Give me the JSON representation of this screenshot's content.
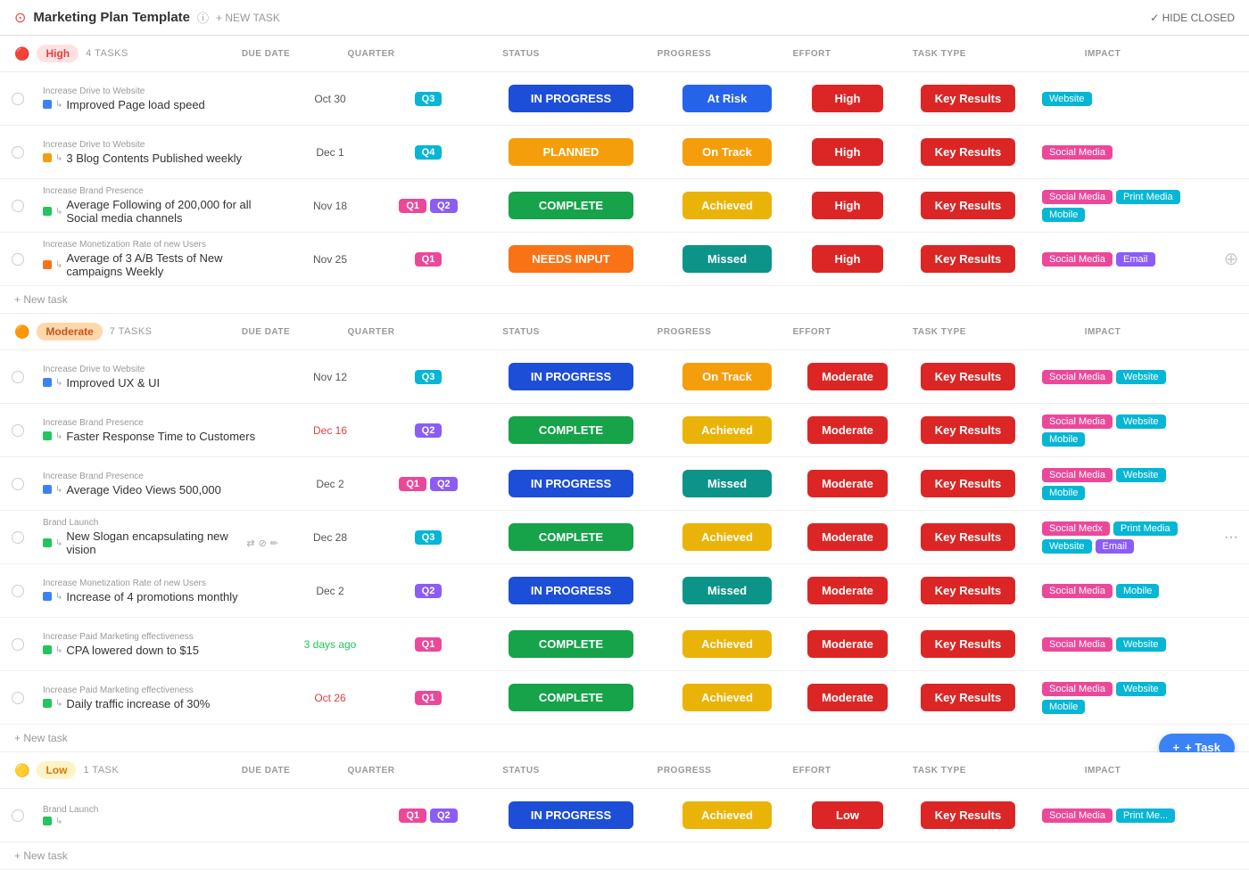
{
  "app": {
    "title": "Marketing Plan Template",
    "new_task_label": "+ NEW TASK",
    "hide_closed_label": "✓ HIDE CLOSED"
  },
  "sections": [
    {
      "id": "high",
      "priority": "High",
      "priority_class": "priority-high",
      "task_count": "4 TASKS",
      "columns": [
        "DUE DATE",
        "QUARTER",
        "STATUS",
        "PROGRESS",
        "EFFORT",
        "TASK TYPE",
        "IMPACT"
      ],
      "tasks": [
        {
          "group": "Increase Drive to Website",
          "name": "Improved Page load speed",
          "dot_class": "dot-blue",
          "due": "Oct 30",
          "due_class": "",
          "quarters": [
            {
              "label": "Q3",
              "class": "q3"
            }
          ],
          "status": "IN PROGRESS",
          "status_class": "status-inprogress",
          "progress": "At Risk",
          "progress_class": "progress-atrisk",
          "effort": "High",
          "task_type": "Key Results",
          "impacts": [
            {
              "label": "Website",
              "class": "tag-cyan"
            }
          ]
        },
        {
          "group": "Increase Drive to Website",
          "name": "3 Blog Contents Published weekly",
          "dot_class": "dot-yellow",
          "due": "Dec 1",
          "due_class": "",
          "quarters": [
            {
              "label": "Q4",
              "class": "q4"
            }
          ],
          "status": "PLANNED",
          "status_class": "status-planned",
          "progress": "On Track",
          "progress_class": "progress-ontrack",
          "effort": "High",
          "task_type": "Key Results",
          "impacts": [
            {
              "label": "Social Media",
              "class": "tag-pink"
            }
          ]
        },
        {
          "group": "Increase Brand Presence",
          "name": "Average Following of 200,000 for all Social media channels",
          "dot_class": "dot-green",
          "due": "Nov 18",
          "due_class": "",
          "quarters": [
            {
              "label": "Q1",
              "class": "q1"
            },
            {
              "label": "Q2",
              "class": "q2"
            }
          ],
          "status": "COMPLETE",
          "status_class": "status-complete",
          "progress": "Achieved",
          "progress_class": "progress-achieved",
          "effort": "High",
          "task_type": "Key Results",
          "impacts": [
            {
              "label": "Social Media",
              "class": "tag-pink"
            },
            {
              "label": "Print Media",
              "class": "tag-cyan"
            },
            {
              "label": "Mobile",
              "class": "tag-cyan"
            }
          ]
        },
        {
          "group": "Increase Monetization Rate of new Users",
          "name": "Average of 3 A/B Tests of New campaigns Weekly",
          "dot_class": "dot-orange",
          "due": "Nov 25",
          "due_class": "",
          "quarters": [
            {
              "label": "Q1",
              "class": "q1"
            }
          ],
          "status": "NEEDS INPUT",
          "status_class": "status-needsinput",
          "progress": "Missed",
          "progress_class": "progress-missed",
          "effort": "High",
          "task_type": "Key Results",
          "impacts": [
            {
              "label": "Social Media",
              "class": "tag-pink"
            },
            {
              "label": "Email",
              "class": "tag-purple"
            }
          ]
        }
      ]
    },
    {
      "id": "moderate",
      "priority": "Moderate",
      "priority_class": "priority-moderate",
      "task_count": "7 TASKS",
      "tasks": [
        {
          "group": "Increase Drive to Website",
          "name": "Improved UX & UI",
          "dot_class": "dot-blue",
          "due": "Nov 12",
          "due_class": "",
          "quarters": [
            {
              "label": "Q3",
              "class": "q3"
            }
          ],
          "status": "IN PROGRESS",
          "status_class": "status-inprogress",
          "progress": "On Track",
          "progress_class": "progress-ontrack",
          "effort": "Moderate",
          "task_type": "Key Results",
          "impacts": [
            {
              "label": "Social Media",
              "class": "tag-pink"
            },
            {
              "label": "Website",
              "class": "tag-cyan"
            }
          ]
        },
        {
          "group": "Increase Brand Presence",
          "name": "Faster Response Time to Customers",
          "dot_class": "dot-green",
          "due": "Dec 16",
          "due_class": "red",
          "quarters": [
            {
              "label": "Q2",
              "class": "q2"
            }
          ],
          "status": "COMPLETE",
          "status_class": "status-complete",
          "progress": "Achieved",
          "progress_class": "progress-achieved",
          "effort": "Moderate",
          "task_type": "Key Results",
          "impacts": [
            {
              "label": "Social Media",
              "class": "tag-pink"
            },
            {
              "label": "Website",
              "class": "tag-cyan"
            },
            {
              "label": "Mobile",
              "class": "tag-cyan"
            }
          ]
        },
        {
          "group": "Increase Brand Presence",
          "name": "Average Video Views 500,000",
          "dot_class": "dot-blue",
          "due": "Dec 2",
          "due_class": "",
          "quarters": [
            {
              "label": "Q1",
              "class": "q1"
            },
            {
              "label": "Q2",
              "class": "q2"
            }
          ],
          "status": "IN PROGRESS",
          "status_class": "status-inprogress",
          "progress": "Missed",
          "progress_class": "progress-missed",
          "effort": "Moderate",
          "task_type": "Key Results",
          "impacts": [
            {
              "label": "Social Media",
              "class": "tag-pink"
            },
            {
              "label": "Website",
              "class": "tag-cyan"
            },
            {
              "label": "Mobile",
              "class": "tag-cyan"
            }
          ]
        },
        {
          "group": "Brand Launch",
          "name": "New Slogan encapsulating new vision",
          "dot_class": "dot-green",
          "due": "Dec 28",
          "due_class": "",
          "quarters": [
            {
              "label": "Q3",
              "class": "q3"
            }
          ],
          "status": "COMPLETE",
          "status_class": "status-complete",
          "progress": "Achieved",
          "progress_class": "progress-achieved",
          "effort": "Moderate",
          "task_type": "Key Results",
          "impacts": [
            {
              "label": "Social Medx",
              "class": "tag-pink"
            },
            {
              "label": "Print Media",
              "class": "tag-cyan"
            },
            {
              "label": "Website",
              "class": "tag-cyan"
            },
            {
              "label": "Email",
              "class": "tag-purple"
            }
          ],
          "has_icons": true
        },
        {
          "group": "Increase Monetization Rate of new Users",
          "name": "Increase of 4 promotions monthly",
          "dot_class": "dot-blue",
          "due": "Dec 2",
          "due_class": "",
          "quarters": [
            {
              "label": "Q2",
              "class": "q2"
            }
          ],
          "status": "IN PROGRESS",
          "status_class": "status-inprogress",
          "progress": "Missed",
          "progress_class": "progress-missed",
          "effort": "Moderate",
          "task_type": "Key Results",
          "impacts": [
            {
              "label": "Social Media",
              "class": "tag-pink"
            },
            {
              "label": "Mobile",
              "class": "tag-cyan"
            }
          ]
        },
        {
          "group": "Increase Paid Marketing effectiveness",
          "name": "CPA lowered down to $15",
          "dot_class": "dot-green",
          "due": "3 days ago",
          "due_class": "overdue",
          "quarters": [
            {
              "label": "Q1",
              "class": "q1"
            }
          ],
          "status": "COMPLETE",
          "status_class": "status-complete",
          "progress": "Achieved",
          "progress_class": "progress-achieved",
          "effort": "Moderate",
          "task_type": "Key Results",
          "impacts": [
            {
              "label": "Social Media",
              "class": "tag-pink"
            },
            {
              "label": "Website",
              "class": "tag-cyan"
            }
          ]
        },
        {
          "group": "Increase Paid Marketing effectiveness",
          "name": "Daily traffic increase of 30%",
          "dot_class": "dot-green",
          "due": "Oct 26",
          "due_class": "red",
          "quarters": [
            {
              "label": "Q1",
              "class": "q1"
            }
          ],
          "status": "COMPLETE",
          "status_class": "status-complete",
          "progress": "Achieved",
          "progress_class": "progress-achieved",
          "effort": "Moderate",
          "task_type": "Key Results",
          "impacts": [
            {
              "label": "Social Media",
              "class": "tag-pink"
            },
            {
              "label": "Website",
              "class": "tag-cyan"
            },
            {
              "label": "Mobile",
              "class": "tag-cyan"
            }
          ]
        }
      ]
    },
    {
      "id": "low",
      "priority": "Low",
      "priority_class": "priority-low",
      "task_count": "1 TASK",
      "tasks": [
        {
          "group": "Brand Launch",
          "name": "",
          "dot_class": "dot-green",
          "due": "",
          "due_class": "",
          "quarters": [
            {
              "label": "Q1",
              "class": "q1"
            },
            {
              "label": "Q2",
              "class": "q2"
            }
          ],
          "status": "IN PROGRESS",
          "status_class": "status-inprogress",
          "progress": "Achieved",
          "progress_class": "progress-achieved",
          "effort": "Low",
          "task_type": "Key Results",
          "impacts": [
            {
              "label": "Social Media",
              "class": "tag-pink"
            },
            {
              "label": "Print Me...",
              "class": "tag-cyan"
            }
          ]
        }
      ]
    }
  ],
  "bottom_btn": "+ Task"
}
